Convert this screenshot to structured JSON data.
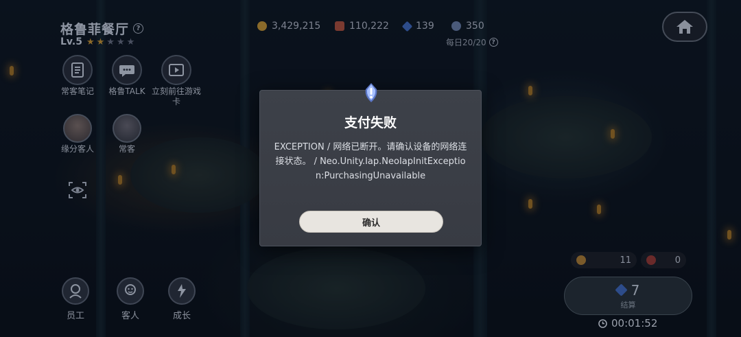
{
  "restaurant": {
    "name": "格鲁菲餐厅",
    "level": "Lv.5",
    "stars_filled": 2,
    "stars_total": 5
  },
  "left_menu": [
    {
      "label": "常客笔记",
      "icon": "notebook-icon"
    },
    {
      "label": "格鲁TALK",
      "icon": "chat-bubble-icon"
    },
    {
      "label": "立刻前往游戏卡",
      "icon": "video-play-icon"
    },
    {
      "label": "缘分客人",
      "icon": "guest-avatar"
    },
    {
      "label": "常客",
      "icon": "regular-avatar"
    }
  ],
  "resources": {
    "gold": "3,429,215",
    "food": "110,222",
    "gem": "139",
    "ticket": "350",
    "daily": "每日20/20"
  },
  "bottom_nav": [
    {
      "label": "员工",
      "icon": "staff-icon"
    },
    {
      "label": "客人",
      "icon": "customer-icon"
    },
    {
      "label": "成长",
      "icon": "growth-icon"
    }
  ],
  "counters": {
    "egg": "11",
    "berry": "0"
  },
  "settle": {
    "value": "7",
    "label": "结算"
  },
  "timer": "00:01:52",
  "dialog": {
    "title": "支付失败",
    "message": "EXCEPTION / 网络已断开。请确认设备的网络连接状态。 / Neo.Unity.Iap.NeoIapInitException:PurchasingUnavailable",
    "confirm_label": "确认"
  },
  "colors": {
    "dialog_bg": "#3a3e46",
    "confirm_bg": "#e8e5e0",
    "alert_icon": "#8fb0ff"
  }
}
